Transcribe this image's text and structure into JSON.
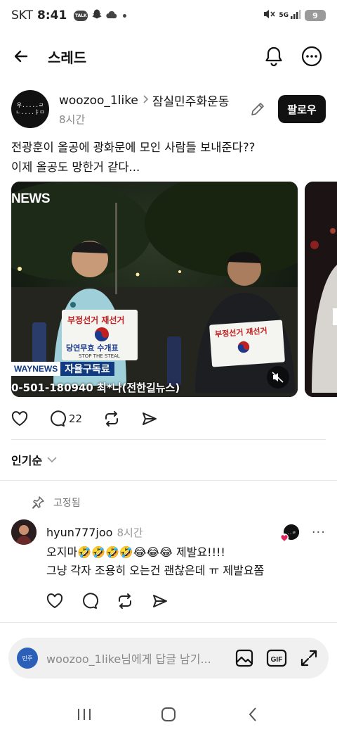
{
  "status_bar": {
    "carrier": "SKT",
    "time": "8:41",
    "talk_badge": "TALK",
    "network": "5G",
    "battery": "9"
  },
  "header": {
    "title": "스레드"
  },
  "post": {
    "avatar_text_1": "우.....ㄹ",
    "avatar_text_2": "ㄴ....ㅑㅁ",
    "username": "woozoo_1like",
    "community": "잠실민주화운동",
    "time": "8시간",
    "follow_label": "팔로우",
    "body_line1": "전광훈이 올공에 광화문에 모인 사람들 보내준다??",
    "body_line2": "이제 올공도 망한거 같다...",
    "media": {
      "news_logo": "NEWS",
      "caption_tag": "WAYNEWS",
      "caption_text": "자율구독료",
      "caption_line2": "0-501-180940 최*나(전한길뉴스)",
      "sign_left_top": "부정선거  재선거",
      "sign_left_bottom": "당연무효   수개표",
      "sign_left_small": "STOP THE STEAL",
      "sign_right_top": "부정선거  재선거"
    },
    "actions": {
      "reply_count": "22"
    }
  },
  "sort": {
    "label": "인기순"
  },
  "pinned": {
    "label": "고정됨"
  },
  "comment": {
    "username": "hyun777joo",
    "time": "8시간",
    "line1": "오지마🤣🤣🤣🤣😂😂😂 제발요!!!!",
    "line2": "그냥 각자 조용히 오는건 괜찮은데 ㅠ 제발요쫌"
  },
  "reply_bar": {
    "avatar_text": "민주",
    "placeholder": "woozoo_1like님에게 답글 남기..."
  },
  "colors": {
    "accent": "#111111",
    "muted": "#888888",
    "heart": "#e0245e"
  }
}
